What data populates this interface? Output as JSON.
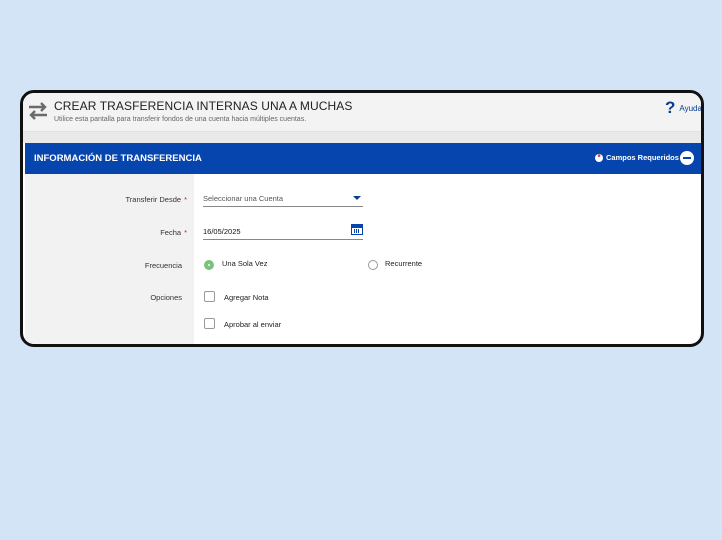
{
  "header": {
    "title": "CREAR TRASFERENCIA INTERNAS UNA A MUCHAS",
    "subtitle": "Utilice esta pantalla para transferir fondos de una cuenta hacia múltiples cuentas.",
    "help_label": "Ayuda",
    "help_icon": "question-icon"
  },
  "section": {
    "title": "INFORMACIÓN DE TRANSFERENCIA",
    "required_label": "Campos Requeridos",
    "required_marker": "*"
  },
  "form": {
    "from_label": "Transferir Desde",
    "from_placeholder": "Seleccionar una Cuenta",
    "date_label": "Fecha",
    "date_value": "16/05/2025",
    "frequency_label": "Frecuencia",
    "frequency_once": "Una Sola Vez",
    "frequency_recurring": "Recurrente",
    "options_label": "Opciones",
    "option_add_note": "Agregar Nota",
    "option_approve": "Aprobar al enviar"
  },
  "colors": {
    "accent": "#0745ae",
    "required": "#d0152b",
    "radio_selected": "#7ac47a",
    "background": "#d3e4f7"
  }
}
